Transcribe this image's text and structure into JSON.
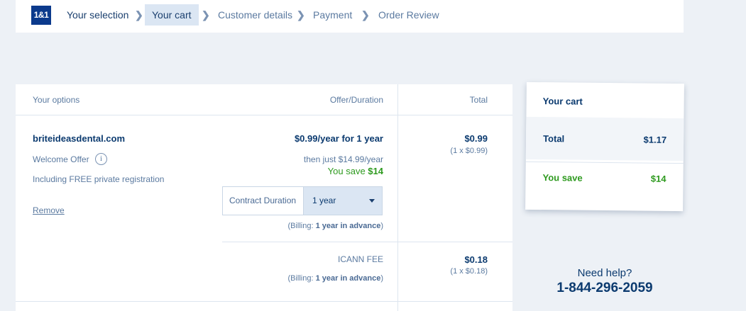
{
  "brand": {
    "logo_text": "1&1"
  },
  "steps": [
    {
      "label": "Your selection",
      "state": "done"
    },
    {
      "label": "Your cart",
      "state": "active"
    },
    {
      "label": "Customer details",
      "state": "upcoming"
    },
    {
      "label": "Payment",
      "state": "upcoming"
    },
    {
      "label": "Order Review",
      "state": "upcoming"
    }
  ],
  "table": {
    "headers": {
      "options": "Your options",
      "offer": "Offer/Duration",
      "total": "Total"
    },
    "domain_item": {
      "domain": "briteideasdental.com",
      "welcome_offer": "Welcome Offer",
      "info_icon": "i",
      "free_registration": "Including FREE private registration",
      "remove_label": "Remove",
      "offer": "$0.99/year for 1 year",
      "then_price": "then just $14.99/year",
      "you_save_prefix": "You save ",
      "you_save_amount": "$14",
      "contract_label": "Contract Duration",
      "contract_value": "1 year",
      "billing_prefix": "(Billing: ",
      "billing_value": "1 year in advance",
      "billing_suffix": ")",
      "total": "$0.99",
      "total_detail": "(1 x $0.99)"
    },
    "icann_item": {
      "label": "ICANN FEE",
      "billing_prefix": "(Billing: ",
      "billing_value": "1 year in advance",
      "billing_suffix": ")",
      "total": "$0.18",
      "total_detail": "(1 x $0.18)"
    }
  },
  "cart": {
    "title": "Your cart",
    "total_label": "Total",
    "total_value": "$1.17",
    "save_label": "You save",
    "save_value": "$14"
  },
  "help": {
    "title": "Need help?",
    "phone": "1-844-296-2059"
  },
  "colors": {
    "brand_blue": "#0b3a8c",
    "text_navy": "#0b3a6f",
    "savings_green": "#2e9a1f",
    "active_step_bg": "#dbe6f3",
    "page_bg": "#edf1f6"
  },
  "icons": [
    "chevron-right-icon",
    "info-icon",
    "caret-down-icon"
  ]
}
